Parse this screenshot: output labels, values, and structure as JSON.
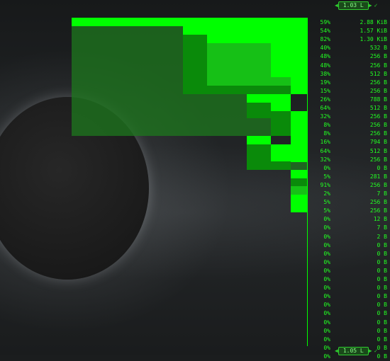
{
  "top_badge": {
    "value": "1.03 L",
    "check": "✓"
  },
  "bottom_badge": {
    "value": "1.05 L",
    "check": "✓"
  },
  "colors": {
    "bright": "#00ff00",
    "medium": "#16c016",
    "dark": "#0a8a0a",
    "dim": "rgba(30,120,30,0.75)",
    "text": "#22ff22"
  },
  "rows": [
    {
      "pct": "59%",
      "size": "2.88 KiB"
    },
    {
      "pct": "54%",
      "size": "1.57 KiB"
    },
    {
      "pct": "82%",
      "size": "1.30 KiB"
    },
    {
      "pct": "40%",
      "size": "532 B"
    },
    {
      "pct": "48%",
      "size": "256 B"
    },
    {
      "pct": "48%",
      "size": "256 B"
    },
    {
      "pct": "38%",
      "size": "512 B"
    },
    {
      "pct": "19%",
      "size": "256 B"
    },
    {
      "pct": "15%",
      "size": "256 B"
    },
    {
      "pct": "26%",
      "size": "788 B"
    },
    {
      "pct": "64%",
      "size": "512 B"
    },
    {
      "pct": "32%",
      "size": "256 B"
    },
    {
      "pct": "8%",
      "size": "256 B"
    },
    {
      "pct": "8%",
      "size": "256 B"
    },
    {
      "pct": "16%",
      "size": "794 B"
    },
    {
      "pct": "64%",
      "size": "512 B"
    },
    {
      "pct": "32%",
      "size": "256 B"
    },
    {
      "pct": "0%",
      "size": "0 B"
    },
    {
      "pct": "5%",
      "size": "281 B"
    },
    {
      "pct": "91%",
      "size": "256 B"
    },
    {
      "pct": "2%",
      "size": "7 B"
    },
    {
      "pct": "5%",
      "size": "256 B"
    },
    {
      "pct": "5%",
      "size": "256 B"
    },
    {
      "pct": "0%",
      "size": "12 B"
    },
    {
      "pct": "0%",
      "size": "7 B"
    },
    {
      "pct": "0%",
      "size": "2 B"
    },
    {
      "pct": "0%",
      "size": "0 B"
    },
    {
      "pct": "0%",
      "size": "0 B"
    },
    {
      "pct": "0%",
      "size": "0 B"
    },
    {
      "pct": "0%",
      "size": "0 B"
    },
    {
      "pct": "0%",
      "size": "0 B"
    },
    {
      "pct": "0%",
      "size": "0 B"
    },
    {
      "pct": "0%",
      "size": "0 B"
    },
    {
      "pct": "0%",
      "size": "0 B"
    },
    {
      "pct": "0%",
      "size": "0 B"
    },
    {
      "pct": "0%",
      "size": "0 B"
    },
    {
      "pct": "0%",
      "size": "0 B"
    },
    {
      "pct": "0%",
      "size": "0 B"
    },
    {
      "pct": "0%",
      "size": "0 B"
    },
    {
      "pct": "0%",
      "size": "0 B"
    }
  ]
}
